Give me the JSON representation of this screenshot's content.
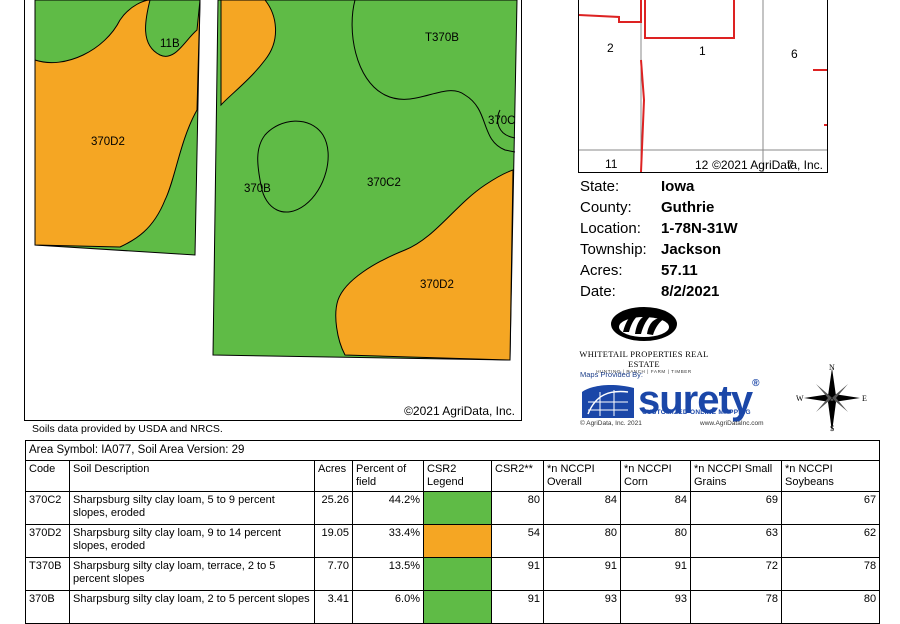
{
  "soil_map": {
    "labels": {
      "l11b": "11B",
      "l370d2_left": "370D2",
      "lt370b": "T370B",
      "l370c": "370C",
      "l370b": "370B",
      "l370c2": "370C2",
      "l370d2_right": "370D2"
    },
    "copyright": "©2021 AgriData, Inc.",
    "colors": {
      "green": "#5fbb46",
      "orange": "#f5a623"
    }
  },
  "source_note": "Soils data provided by USDA and NRCS.",
  "inset_map": {
    "sections": {
      "s2": "2",
      "s1": "1",
      "s6": "6",
      "s11": "11",
      "s12": "12",
      "s7": "7"
    },
    "copyright": "©2021 AgriData, Inc."
  },
  "info": [
    {
      "key": "State:",
      "value": "Iowa"
    },
    {
      "key": "County:",
      "value": "Guthrie"
    },
    {
      "key": "Location:",
      "value": "1-78N-31W"
    },
    {
      "key": "Township:",
      "value": "Jackson"
    },
    {
      "key": "Acres:",
      "value": "57.11"
    },
    {
      "key": "Date:",
      "value": "8/2/2021"
    }
  ],
  "logos": {
    "whitetail_name": "WHITETAIL PROPERTIES REAL ESTATE",
    "whitetail_tag": "HUNTING | RANCH | FARM | TIMBER",
    "surety_provided": "Maps Provided By:",
    "surety_word": "surety",
    "surety_reg": "®",
    "surety_tagline": "CUSTOMIZED ONLINE MAPPING",
    "surety_foot_left": "© AgriData, Inc. 2021",
    "surety_foot_right": "www.AgriDataInc.com"
  },
  "compass": {
    "n": "N",
    "s": "S",
    "e": "E",
    "w": "W"
  },
  "table": {
    "area_symbol": "Area Symbol: IA077, Soil Area Version: 29",
    "headers": {
      "code": "Code",
      "desc": "Soil Description",
      "acres": "Acres",
      "pct": "Percent of field",
      "legend": "CSR2 Legend",
      "csr2": "CSR2**",
      "overall": "*n NCCPI Overall",
      "corn": "*n NCCPI Corn",
      "small": "*n NCCPI Small Grains",
      "soy": "*n NCCPI Soybeans"
    },
    "rows": [
      {
        "code": "370C2",
        "desc": "Sharpsburg silty clay loam, 5 to 9 percent slopes, eroded",
        "acres": "25.26",
        "pct": "44.2%",
        "legend_color": "#5fbb46",
        "csr2": "80",
        "overall": "84",
        "corn": "84",
        "small": "69",
        "soy": "67"
      },
      {
        "code": "370D2",
        "desc": "Sharpsburg silty clay loam, 9 to 14 percent slopes, eroded",
        "acres": "19.05",
        "pct": "33.4%",
        "legend_color": "#f5a623",
        "csr2": "54",
        "overall": "80",
        "corn": "80",
        "small": "63",
        "soy": "62"
      },
      {
        "code": "T370B",
        "desc": "Sharpsburg silty clay loam, terrace, 2 to 5 percent slopes",
        "acres": "7.70",
        "pct": "13.5%",
        "legend_color": "#5fbb46",
        "csr2": "91",
        "overall": "91",
        "corn": "91",
        "small": "72",
        "soy": "78"
      },
      {
        "code": "370B",
        "desc": "Sharpsburg silty clay loam, 2 to 5 percent slopes",
        "acres": "3.41",
        "pct": "6.0%",
        "legend_color": "#5fbb46",
        "csr2": "91",
        "overall": "93",
        "corn": "93",
        "small": "78",
        "soy": "80"
      }
    ]
  }
}
